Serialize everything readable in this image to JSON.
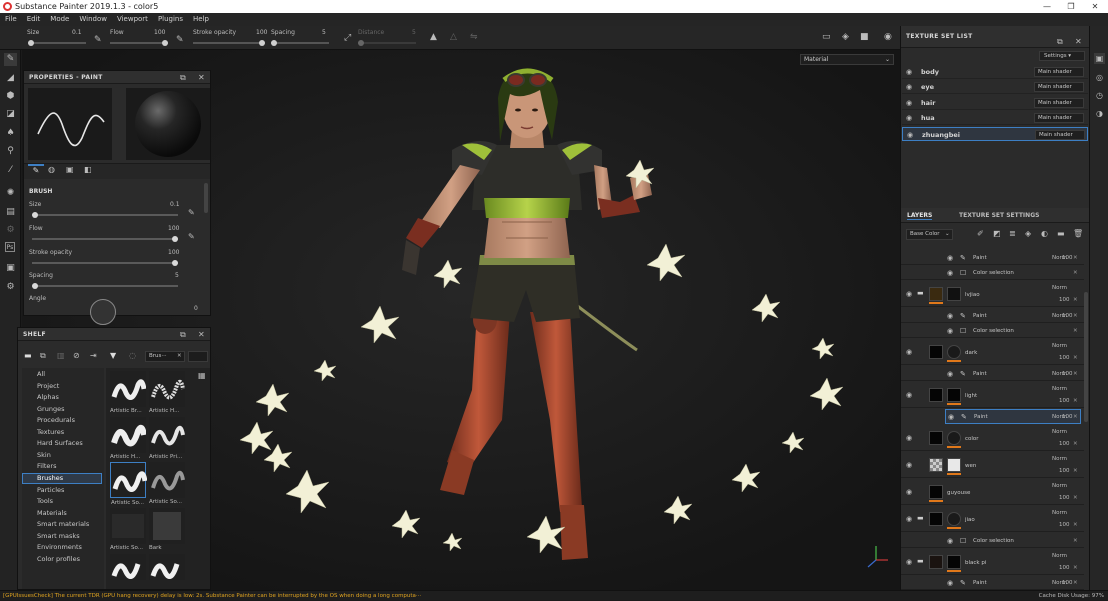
{
  "window": {
    "title": "Substance Painter 2019.1.3 - color5",
    "minimize": "—",
    "maximize": "❐",
    "close": "✕"
  },
  "menu": [
    "File",
    "Edit",
    "Mode",
    "Window",
    "Viewport",
    "Plugins",
    "Help"
  ],
  "toolbar": {
    "size_label": "Size",
    "size_value": "0.1",
    "flow_label": "Flow",
    "flow_value": "100",
    "stroke_label": "Stroke opacity",
    "stroke_value": "100",
    "spacing_label": "Spacing",
    "spacing_value": "5",
    "distance_label": "Distance",
    "distance_value": "5",
    "material_select": "Material"
  },
  "properties_panel": {
    "title": "PROPERTIES - PAINT",
    "section": "BRUSH",
    "size_label": "Size",
    "size_value": "0.1",
    "size_level": 0,
    "flow_label": "Flow",
    "flow_value": "100",
    "flow_level": 1,
    "stroke_label": "Stroke opacity",
    "stroke_value": "100",
    "stroke_level": 1,
    "spacing_label": "Spacing",
    "spacing_value": "5",
    "spacing_level": 0,
    "angle_label": "Angle",
    "angle_value": "0"
  },
  "shelf": {
    "title": "SHELF",
    "search_value": "Brus···",
    "categories": [
      "All",
      "Project",
      "Alphas",
      "Grunges",
      "Procedurals",
      "Textures",
      "Hard Surfaces",
      "Skin",
      "Filters",
      "Brushes",
      "Particles",
      "Tools",
      "Materials",
      "Smart materials",
      "Smart masks",
      "Environments",
      "Color profiles"
    ],
    "selected_category": "Brushes",
    "thumbnails": [
      "Artistic Br...",
      "Artistic H...",
      "Artistic H...",
      "Artistic Pri...",
      "Artistic So...",
      "Artistic So...",
      "Artistic So...",
      "Bark",
      "",
      ""
    ]
  },
  "texture_set_list": {
    "title": "TEXTURE SET LIST",
    "settings_label": "Settings ▾",
    "sets": [
      {
        "name": "body",
        "shader": "Main shader"
      },
      {
        "name": "eye",
        "shader": "Main shader"
      },
      {
        "name": "hair",
        "shader": "Main shader"
      },
      {
        "name": "hua",
        "shader": "Main shader"
      },
      {
        "name": "zhuangbei",
        "shader": "Main shader"
      }
    ]
  },
  "layers": {
    "tab_layers": "LAYERS",
    "tab_settings": "TEXTURE SET SETTINGS",
    "channel_select": "Base Color",
    "rows": [
      {
        "kind": "sub",
        "name": "Paint",
        "blend": "Norm",
        "opacity": "100"
      },
      {
        "kind": "sub",
        "name": "Color selection"
      },
      {
        "kind": "folder",
        "name": "lvjiao",
        "blend": "Norm",
        "opacity": "100",
        "blend2": "Norm",
        "opacity2": "100"
      },
      {
        "kind": "sub",
        "name": "Paint",
        "blend": "Norm",
        "opacity": "100"
      },
      {
        "kind": "sub",
        "name": "Color selection"
      },
      {
        "kind": "layer",
        "name": "dark",
        "blend": "Norm",
        "opacity": "100",
        "blend2": "Norm",
        "opacity2": "100"
      },
      {
        "kind": "sub",
        "name": "Paint",
        "blend": "Norm",
        "opacity": "100"
      },
      {
        "kind": "layer",
        "name": "light",
        "blend": "Norm",
        "opacity": "100",
        "blend2": "Norm",
        "opacity2": "100"
      },
      {
        "kind": "sub",
        "name": "Paint",
        "blend": "Norm",
        "opacity": "100"
      },
      {
        "kind": "layer",
        "name": "color",
        "blend": "Norm",
        "opacity": "100",
        "blend2": "Norm",
        "opacity2": "100"
      },
      {
        "kind": "layer",
        "name": "wen",
        "blend": "Norm",
        "opacity": "100",
        "blend2": "Norm",
        "opacity2": "100"
      },
      {
        "kind": "layer",
        "name": "guyouse",
        "blend": "Norm",
        "opacity": "100",
        "blend2": "Norm",
        "opacity2": "100"
      },
      {
        "kind": "folder",
        "name": "jiao",
        "blend": "Norm",
        "opacity": "100",
        "blend2": "Norm",
        "opacity2": "100"
      },
      {
        "kind": "sub",
        "name": "Color selection"
      },
      {
        "kind": "folder",
        "name": "black pi",
        "blend": "Norm",
        "opacity": "100",
        "blend2": "Norm",
        "opacity2": "100"
      },
      {
        "kind": "sub",
        "name": "Paint",
        "blend": "Norm",
        "opacity": "100"
      }
    ]
  },
  "status": {
    "message": "[GPUIssuesCheck] The current TDR (GPU hang recovery) delay is low: 2s. Substance Painter can be interrupted by the OS when doing a long computa···",
    "cache": "Cache Disk Usage:  97%"
  },
  "colors": {
    "accent": "#e0781a",
    "selection": "#3d7fc4",
    "warning": "#e0a420"
  }
}
